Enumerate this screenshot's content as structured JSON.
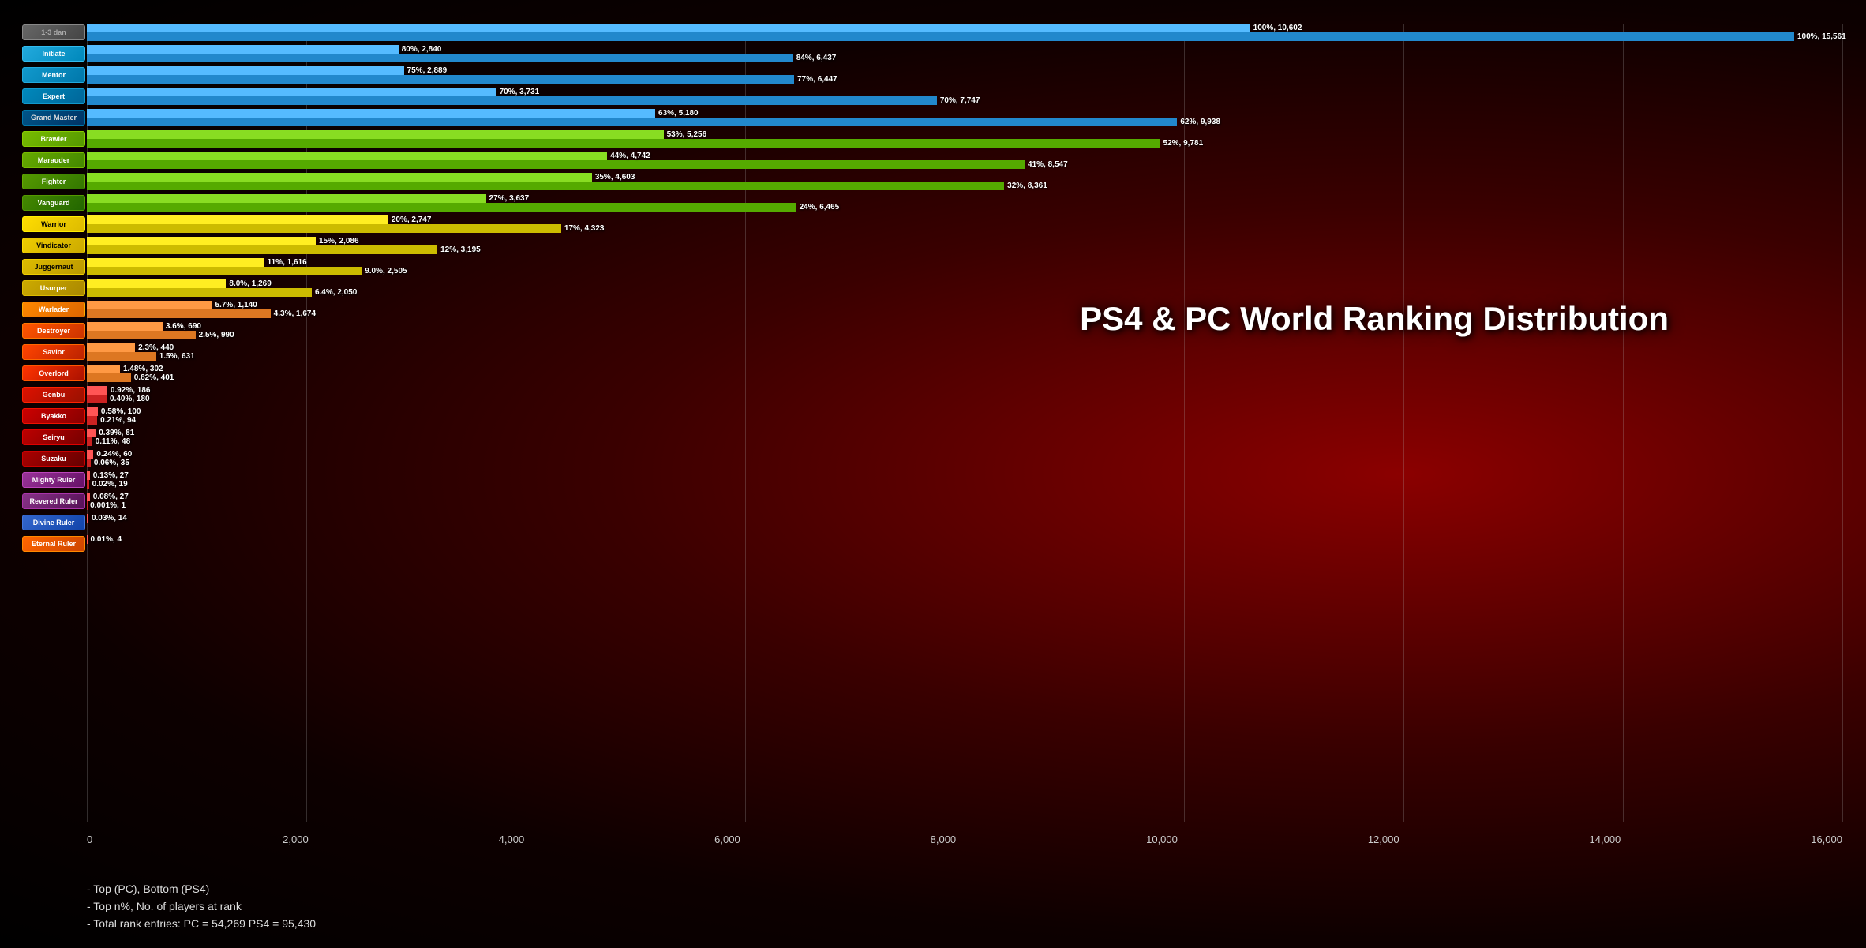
{
  "title": "PS4 & PC World Ranking Distribution",
  "chart": {
    "x_max": 16000,
    "x_labels": [
      "0",
      "2,000",
      "4,000",
      "6,000",
      "8,000",
      "10,000",
      "12,000",
      "14,000",
      "16,000"
    ],
    "ranks": [
      {
        "name": "1-3 dan",
        "badge_color": "#555",
        "text_color": "#fff",
        "pc_pct": "100%",
        "pc_val": 10602,
        "ps4_pct": "100%",
        "ps4_val": 15561,
        "pc_color": "#5599dd",
        "ps4_color": "#3366bb"
      },
      {
        "name": "Initiate",
        "badge_color": "#2299cc",
        "text_color": "#fff",
        "pc_pct": "80%",
        "pc_val": 2840,
        "ps4_pct": "84%",
        "ps4_val": 6437,
        "pc_color": "#44aaee",
        "ps4_color": "#3388cc"
      },
      {
        "name": "Mentor",
        "badge_color": "#1188bb",
        "text_color": "#fff",
        "pc_pct": "75%",
        "pc_val": 2889,
        "ps4_pct": "77%",
        "ps4_val": 6447,
        "pc_color": "#44aaee",
        "ps4_color": "#3388cc"
      },
      {
        "name": "Expert",
        "badge_color": "#0077aa",
        "text_color": "#fff",
        "pc_pct": "70%",
        "pc_val": 3731,
        "ps4_pct": "70%",
        "ps4_val": 7747,
        "pc_color": "#44aaee",
        "ps4_color": "#3388cc"
      },
      {
        "name": "Grand Master",
        "badge_color": "#005588",
        "text_color": "#fff",
        "pc_pct": "63%",
        "pc_val": 5180,
        "ps4_pct": "62%",
        "ps4_val": 9938,
        "pc_color": "#44aaee",
        "ps4_color": "#3388cc"
      },
      {
        "name": "Brawler",
        "badge_color": "#66aa00",
        "text_color": "#fff",
        "pc_pct": "53%",
        "pc_val": 5256,
        "ps4_pct": "52%",
        "ps4_val": 9781,
        "pc_color": "#77cc11",
        "ps4_color": "#55aa00"
      },
      {
        "name": "Marauder",
        "badge_color": "#55990",
        "text_color": "#fff",
        "pc_pct": "44%",
        "pc_val": 4742,
        "ps4_pct": "41%",
        "ps4_val": 8547,
        "pc_color": "#77cc11",
        "ps4_color": "#55aa00"
      },
      {
        "name": "Fighter",
        "badge_color": "#448800",
        "text_color": "#fff",
        "pc_pct": "35%",
        "pc_val": 4603,
        "ps4_pct": "32%",
        "ps4_val": 8361,
        "pc_color": "#77cc11",
        "ps4_color": "#55aa00"
      },
      {
        "name": "Vanguard",
        "badge_color": "#337700",
        "text_color": "#fff",
        "pc_pct": "27%",
        "pc_val": 3637,
        "ps4_pct": "24%",
        "ps4_val": 6465,
        "pc_color": "#77cc11",
        "ps4_color": "#55aa00"
      },
      {
        "name": "Warrior",
        "badge_color": "#ddcc00",
        "text_color": "#000",
        "pc_pct": "20%",
        "pc_val": 2747,
        "ps4_pct": "17%",
        "ps4_val": 4323,
        "pc_color": "#ffee00",
        "ps4_color": "#ccbb00"
      },
      {
        "name": "Vindicator",
        "badge_color": "#ccbb00",
        "text_color": "#000",
        "pc_pct": "15%",
        "pc_val": 2086,
        "ps4_pct": "12%",
        "ps4_val": 3195,
        "pc_color": "#ffee00",
        "ps4_color": "#ccbb00"
      },
      {
        "name": "Juggernaut",
        "badge_color": "#bbaa00",
        "text_color": "#000",
        "pc_pct": "11%",
        "pc_val": 1616,
        "ps4_pct": "9.0%",
        "ps4_val": 2505,
        "pc_color": "#ffee00",
        "ps4_color": "#ccbb00"
      },
      {
        "name": "Usurper",
        "badge_color": "#aa9900",
        "text_color": "#000",
        "pc_pct": "8.0%",
        "pc_val": 1269,
        "ps4_pct": "6.4%",
        "ps4_val": 2050,
        "pc_color": "#ffee00",
        "ps4_color": "#ccbb00"
      },
      {
        "name": "Warlader",
        "badge_color": "#ff7700",
        "text_color": "#fff",
        "pc_pct": "5.7%",
        "pc_val": 1140,
        "ps4_pct": "4.3%",
        "ps4_val": 1674,
        "pc_color": "#ff9922",
        "ps4_color": "#dd7700"
      },
      {
        "name": "Destroyer",
        "badge_color": "#ff5500",
        "text_color": "#fff",
        "pc_pct": "3.6%",
        "pc_val": 690,
        "ps4_pct": "2.5%",
        "ps4_val": 990,
        "pc_color": "#ff7744",
        "ps4_color": "#ee5522"
      },
      {
        "name": "Savior",
        "badge_color": "#ff4400",
        "text_color": "#fff",
        "pc_pct": "2.3%",
        "pc_val": 440,
        "ps4_pct": "1.5%",
        "ps4_val": 631,
        "pc_color": "#ff7744",
        "ps4_color": "#ee5522"
      },
      {
        "name": "Overlord",
        "badge_color": "#ff3300",
        "text_color": "#fff",
        "pc_pct": "1.48%",
        "pc_val": 302,
        "ps4_pct": "0.82%",
        "ps4_val": 401,
        "pc_color": "#ff7744",
        "ps4_color": "#ee5522"
      },
      {
        "name": "Genbu",
        "badge_color": "#ff2200",
        "text_color": "#fff",
        "pc_pct": "0.92%",
        "pc_val": 186,
        "ps4_pct": "0.40%",
        "ps4_val": 180,
        "pc_color": "#ff4444",
        "ps4_color": "#cc2222"
      },
      {
        "name": "Byakko",
        "badge_color": "#ee1100",
        "text_color": "#fff",
        "pc_pct": "0.58%",
        "pc_val": 100,
        "ps4_pct": "0.21%",
        "ps4_val": 94,
        "pc_color": "#ff4444",
        "ps4_color": "#cc2222"
      },
      {
        "name": "Seiryu",
        "badge_color": "#dd0000",
        "text_color": "#fff",
        "pc_pct": "0.39%",
        "pc_val": 81,
        "ps4_pct": "0.11%",
        "ps4_val": 48,
        "pc_color": "#ff4444",
        "ps4_color": "#cc2222"
      },
      {
        "name": "Suzaku",
        "badge_color": "#cc0000",
        "text_color": "#fff",
        "pc_pct": "0.24%",
        "pc_val": 60,
        "ps4_pct": "0.06%",
        "ps4_val": 35,
        "pc_color": "#ff4444",
        "ps4_color": "#cc2222"
      },
      {
        "name": "Mighty Ruler",
        "badge_color": "#bb0000",
        "text_color": "#fff",
        "pc_pct": "0.13%",
        "pc_val": 27,
        "ps4_pct": "0.02%",
        "ps4_val": 19,
        "pc_color": "#ff4444",
        "ps4_color": "#cc2222"
      },
      {
        "name": "Revered Ruler",
        "badge_color": "#aa0000",
        "text_color": "#fff",
        "pc_pct": "0.08%",
        "pc_val": 27,
        "ps4_pct": "0.001%",
        "ps4_val": 1,
        "pc_color": "#ff4444",
        "ps4_color": "#cc2222"
      },
      {
        "name": "Divine Ruler",
        "badge_color": "#990000",
        "text_color": "#fff",
        "pc_pct": "0.03%",
        "pc_val": 14,
        "ps4_pct": "0.000%",
        "ps4_val": 0,
        "pc_color": "#ff4444",
        "ps4_color": "#cc2222"
      },
      {
        "name": "Eternal Ruler",
        "badge_color": "#880000",
        "text_color": "#fff",
        "pc_pct": "0.01%",
        "pc_val": 4,
        "ps4_pct": "0.000%",
        "ps4_val": 0,
        "pc_color": "#ff4444",
        "ps4_color": "#cc2222"
      }
    ]
  },
  "legend": {
    "line1": "- Top (PC), Bottom (PS4)",
    "line2": "- Top n%, No. of players at rank",
    "line3": "- Total rank entries: PC = 54,269 PS4 = 95,430"
  }
}
